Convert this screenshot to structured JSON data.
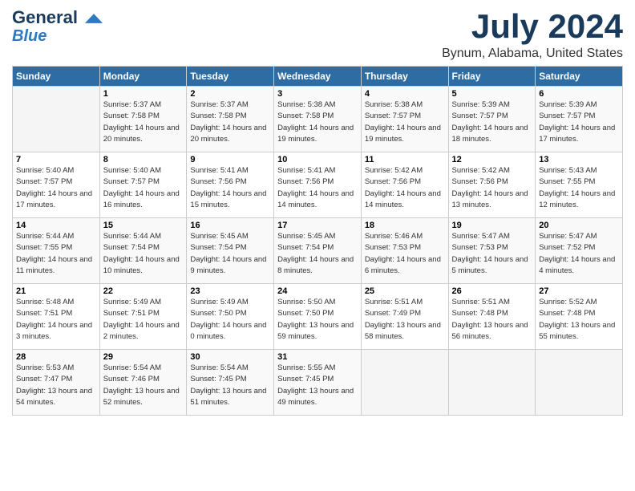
{
  "header": {
    "logo_line1": "General",
    "logo_line2": "Blue",
    "month": "July 2024",
    "location": "Bynum, Alabama, United States"
  },
  "weekdays": [
    "Sunday",
    "Monday",
    "Tuesday",
    "Wednesday",
    "Thursday",
    "Friday",
    "Saturday"
  ],
  "weeks": [
    [
      {
        "day": "",
        "empty": true
      },
      {
        "day": "1",
        "sunrise": "Sunrise: 5:37 AM",
        "sunset": "Sunset: 7:58 PM",
        "daylight": "Daylight: 14 hours and 20 minutes."
      },
      {
        "day": "2",
        "sunrise": "Sunrise: 5:37 AM",
        "sunset": "Sunset: 7:58 PM",
        "daylight": "Daylight: 14 hours and 20 minutes."
      },
      {
        "day": "3",
        "sunrise": "Sunrise: 5:38 AM",
        "sunset": "Sunset: 7:58 PM",
        "daylight": "Daylight: 14 hours and 19 minutes."
      },
      {
        "day": "4",
        "sunrise": "Sunrise: 5:38 AM",
        "sunset": "Sunset: 7:57 PM",
        "daylight": "Daylight: 14 hours and 19 minutes."
      },
      {
        "day": "5",
        "sunrise": "Sunrise: 5:39 AM",
        "sunset": "Sunset: 7:57 PM",
        "daylight": "Daylight: 14 hours and 18 minutes."
      },
      {
        "day": "6",
        "sunrise": "Sunrise: 5:39 AM",
        "sunset": "Sunset: 7:57 PM",
        "daylight": "Daylight: 14 hours and 17 minutes."
      }
    ],
    [
      {
        "day": "7",
        "sunrise": "Sunrise: 5:40 AM",
        "sunset": "Sunset: 7:57 PM",
        "daylight": "Daylight: 14 hours and 17 minutes."
      },
      {
        "day": "8",
        "sunrise": "Sunrise: 5:40 AM",
        "sunset": "Sunset: 7:57 PM",
        "daylight": "Daylight: 14 hours and 16 minutes."
      },
      {
        "day": "9",
        "sunrise": "Sunrise: 5:41 AM",
        "sunset": "Sunset: 7:56 PM",
        "daylight": "Daylight: 14 hours and 15 minutes."
      },
      {
        "day": "10",
        "sunrise": "Sunrise: 5:41 AM",
        "sunset": "Sunset: 7:56 PM",
        "daylight": "Daylight: 14 hours and 14 minutes."
      },
      {
        "day": "11",
        "sunrise": "Sunrise: 5:42 AM",
        "sunset": "Sunset: 7:56 PM",
        "daylight": "Daylight: 14 hours and 14 minutes."
      },
      {
        "day": "12",
        "sunrise": "Sunrise: 5:42 AM",
        "sunset": "Sunset: 7:56 PM",
        "daylight": "Daylight: 14 hours and 13 minutes."
      },
      {
        "day": "13",
        "sunrise": "Sunrise: 5:43 AM",
        "sunset": "Sunset: 7:55 PM",
        "daylight": "Daylight: 14 hours and 12 minutes."
      }
    ],
    [
      {
        "day": "14",
        "sunrise": "Sunrise: 5:44 AM",
        "sunset": "Sunset: 7:55 PM",
        "daylight": "Daylight: 14 hours and 11 minutes."
      },
      {
        "day": "15",
        "sunrise": "Sunrise: 5:44 AM",
        "sunset": "Sunset: 7:54 PM",
        "daylight": "Daylight: 14 hours and 10 minutes."
      },
      {
        "day": "16",
        "sunrise": "Sunrise: 5:45 AM",
        "sunset": "Sunset: 7:54 PM",
        "daylight": "Daylight: 14 hours and 9 minutes."
      },
      {
        "day": "17",
        "sunrise": "Sunrise: 5:45 AM",
        "sunset": "Sunset: 7:54 PM",
        "daylight": "Daylight: 14 hours and 8 minutes."
      },
      {
        "day": "18",
        "sunrise": "Sunrise: 5:46 AM",
        "sunset": "Sunset: 7:53 PM",
        "daylight": "Daylight: 14 hours and 6 minutes."
      },
      {
        "day": "19",
        "sunrise": "Sunrise: 5:47 AM",
        "sunset": "Sunset: 7:53 PM",
        "daylight": "Daylight: 14 hours and 5 minutes."
      },
      {
        "day": "20",
        "sunrise": "Sunrise: 5:47 AM",
        "sunset": "Sunset: 7:52 PM",
        "daylight": "Daylight: 14 hours and 4 minutes."
      }
    ],
    [
      {
        "day": "21",
        "sunrise": "Sunrise: 5:48 AM",
        "sunset": "Sunset: 7:51 PM",
        "daylight": "Daylight: 14 hours and 3 minutes."
      },
      {
        "day": "22",
        "sunrise": "Sunrise: 5:49 AM",
        "sunset": "Sunset: 7:51 PM",
        "daylight": "Daylight: 14 hours and 2 minutes."
      },
      {
        "day": "23",
        "sunrise": "Sunrise: 5:49 AM",
        "sunset": "Sunset: 7:50 PM",
        "daylight": "Daylight: 14 hours and 0 minutes."
      },
      {
        "day": "24",
        "sunrise": "Sunrise: 5:50 AM",
        "sunset": "Sunset: 7:50 PM",
        "daylight": "Daylight: 13 hours and 59 minutes."
      },
      {
        "day": "25",
        "sunrise": "Sunrise: 5:51 AM",
        "sunset": "Sunset: 7:49 PM",
        "daylight": "Daylight: 13 hours and 58 minutes."
      },
      {
        "day": "26",
        "sunrise": "Sunrise: 5:51 AM",
        "sunset": "Sunset: 7:48 PM",
        "daylight": "Daylight: 13 hours and 56 minutes."
      },
      {
        "day": "27",
        "sunrise": "Sunrise: 5:52 AM",
        "sunset": "Sunset: 7:48 PM",
        "daylight": "Daylight: 13 hours and 55 minutes."
      }
    ],
    [
      {
        "day": "28",
        "sunrise": "Sunrise: 5:53 AM",
        "sunset": "Sunset: 7:47 PM",
        "daylight": "Daylight: 13 hours and 54 minutes."
      },
      {
        "day": "29",
        "sunrise": "Sunrise: 5:54 AM",
        "sunset": "Sunset: 7:46 PM",
        "daylight": "Daylight: 13 hours and 52 minutes."
      },
      {
        "day": "30",
        "sunrise": "Sunrise: 5:54 AM",
        "sunset": "Sunset: 7:45 PM",
        "daylight": "Daylight: 13 hours and 51 minutes."
      },
      {
        "day": "31",
        "sunrise": "Sunrise: 5:55 AM",
        "sunset": "Sunset: 7:45 PM",
        "daylight": "Daylight: 13 hours and 49 minutes."
      },
      {
        "day": "",
        "empty": true
      },
      {
        "day": "",
        "empty": true
      },
      {
        "day": "",
        "empty": true
      }
    ]
  ]
}
